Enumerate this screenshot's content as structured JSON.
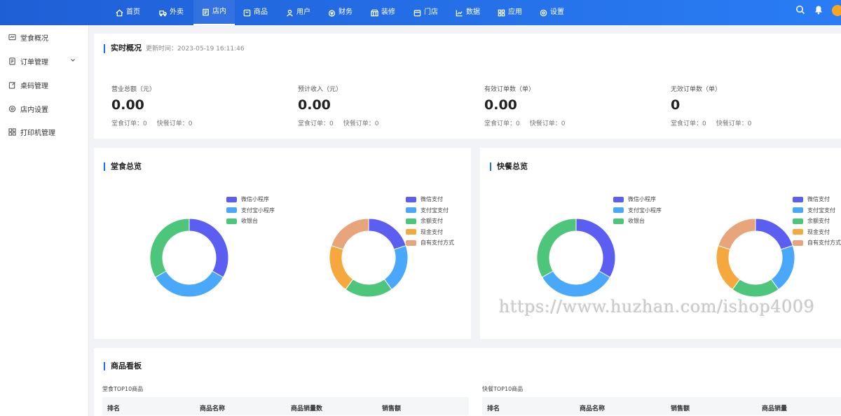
{
  "nav": {
    "items": [
      {
        "label": "首页",
        "icon": "home-icon"
      },
      {
        "label": "外卖",
        "icon": "delivery-icon"
      },
      {
        "label": "店内",
        "icon": "store-inside-icon",
        "active": true
      },
      {
        "label": "商品",
        "icon": "goods-icon"
      },
      {
        "label": "用户",
        "icon": "user-icon"
      },
      {
        "label": "财务",
        "icon": "finance-icon"
      },
      {
        "label": "装修",
        "icon": "decorate-icon"
      },
      {
        "label": "门店",
        "icon": "shop-icon"
      },
      {
        "label": "数据",
        "icon": "data-icon"
      },
      {
        "label": "应用",
        "icon": "apps-icon"
      },
      {
        "label": "设置",
        "icon": "settings-icon"
      }
    ]
  },
  "sidebar": {
    "items": [
      {
        "label": "堂食概况",
        "icon": "overview-icon"
      },
      {
        "label": "订单管理",
        "icon": "order-icon",
        "expandable": true
      },
      {
        "label": "桌码管理",
        "icon": "table-code-icon"
      },
      {
        "label": "店内设置",
        "icon": "gear-icon"
      },
      {
        "label": "打印机管理",
        "icon": "printer-icon"
      }
    ]
  },
  "realtime": {
    "title": "实时概况",
    "updated": "更新时间：2023-05-19 16:11:46",
    "stats": [
      {
        "label": "营业总额（元）",
        "value": "0.00",
        "dine": "堂食订单：0",
        "fast": "快餐订单：0"
      },
      {
        "label": "预计收入（元）",
        "value": "0.00",
        "dine": "堂食订单：0",
        "fast": "快餐订单：0"
      },
      {
        "label": "有效订单数（单）",
        "value": "0.00",
        "dine": "堂食订单：0",
        "fast": "快餐订单：0"
      },
      {
        "label": "无效订单数（单）",
        "value": "0",
        "dine": "堂食订单：0",
        "fast": "快餐订单：0"
      }
    ]
  },
  "dine_overview": {
    "title": "堂食总览",
    "channel_legend": [
      "微信小程序",
      "支付宝小程序",
      "收银台"
    ],
    "payment_legend": [
      "微信支付",
      "支付宝支付",
      "余额支付",
      "现金支付",
      "自有支付方式"
    ]
  },
  "fast_overview": {
    "title": "快餐总览",
    "channel_legend": [
      "微信小程序",
      "支付宝小程序",
      "收银台"
    ],
    "payment_legend": [
      "微信支付",
      "支付宝支付",
      "余额支付",
      "现金支付",
      "自有支付方式"
    ]
  },
  "colors": {
    "primary": "#1d6ef0",
    "series": [
      "#5b5ef0",
      "#4aa8fa",
      "#4dc57a",
      "#f5a83d",
      "#e8a47a"
    ]
  },
  "chart_data": [
    {
      "type": "pie",
      "categories": [
        "微信小程序",
        "支付宝小程序",
        "收银台"
      ],
      "values": [
        1,
        1,
        1
      ]
    },
    {
      "type": "pie",
      "categories": [
        "微信支付",
        "支付宝支付",
        "余额支付",
        "现金支付",
        "自有支付方式"
      ],
      "values": [
        1,
        1,
        1,
        1,
        1
      ]
    },
    {
      "type": "pie",
      "categories": [
        "微信小程序",
        "支付宝小程序",
        "收银台"
      ],
      "values": [
        1,
        1,
        1
      ]
    },
    {
      "type": "pie",
      "categories": [
        "微信支付",
        "支付宝支付",
        "余额支付",
        "现金支付",
        "自有支付方式"
      ],
      "values": [
        1,
        1,
        1,
        1,
        1
      ]
    }
  ],
  "watermark": "https://www.huzhan.com/ishop4009",
  "goods_board": {
    "title": "商品看板",
    "dine_caption": "堂食TOP10商品",
    "dine_columns": [
      "排名",
      "商品名称",
      "商品销量数",
      "销售额"
    ],
    "fast_caption": "快餐TOP10商品",
    "fast_columns": [
      "排名",
      "商品名称",
      "销售额",
      "商品销量"
    ]
  }
}
